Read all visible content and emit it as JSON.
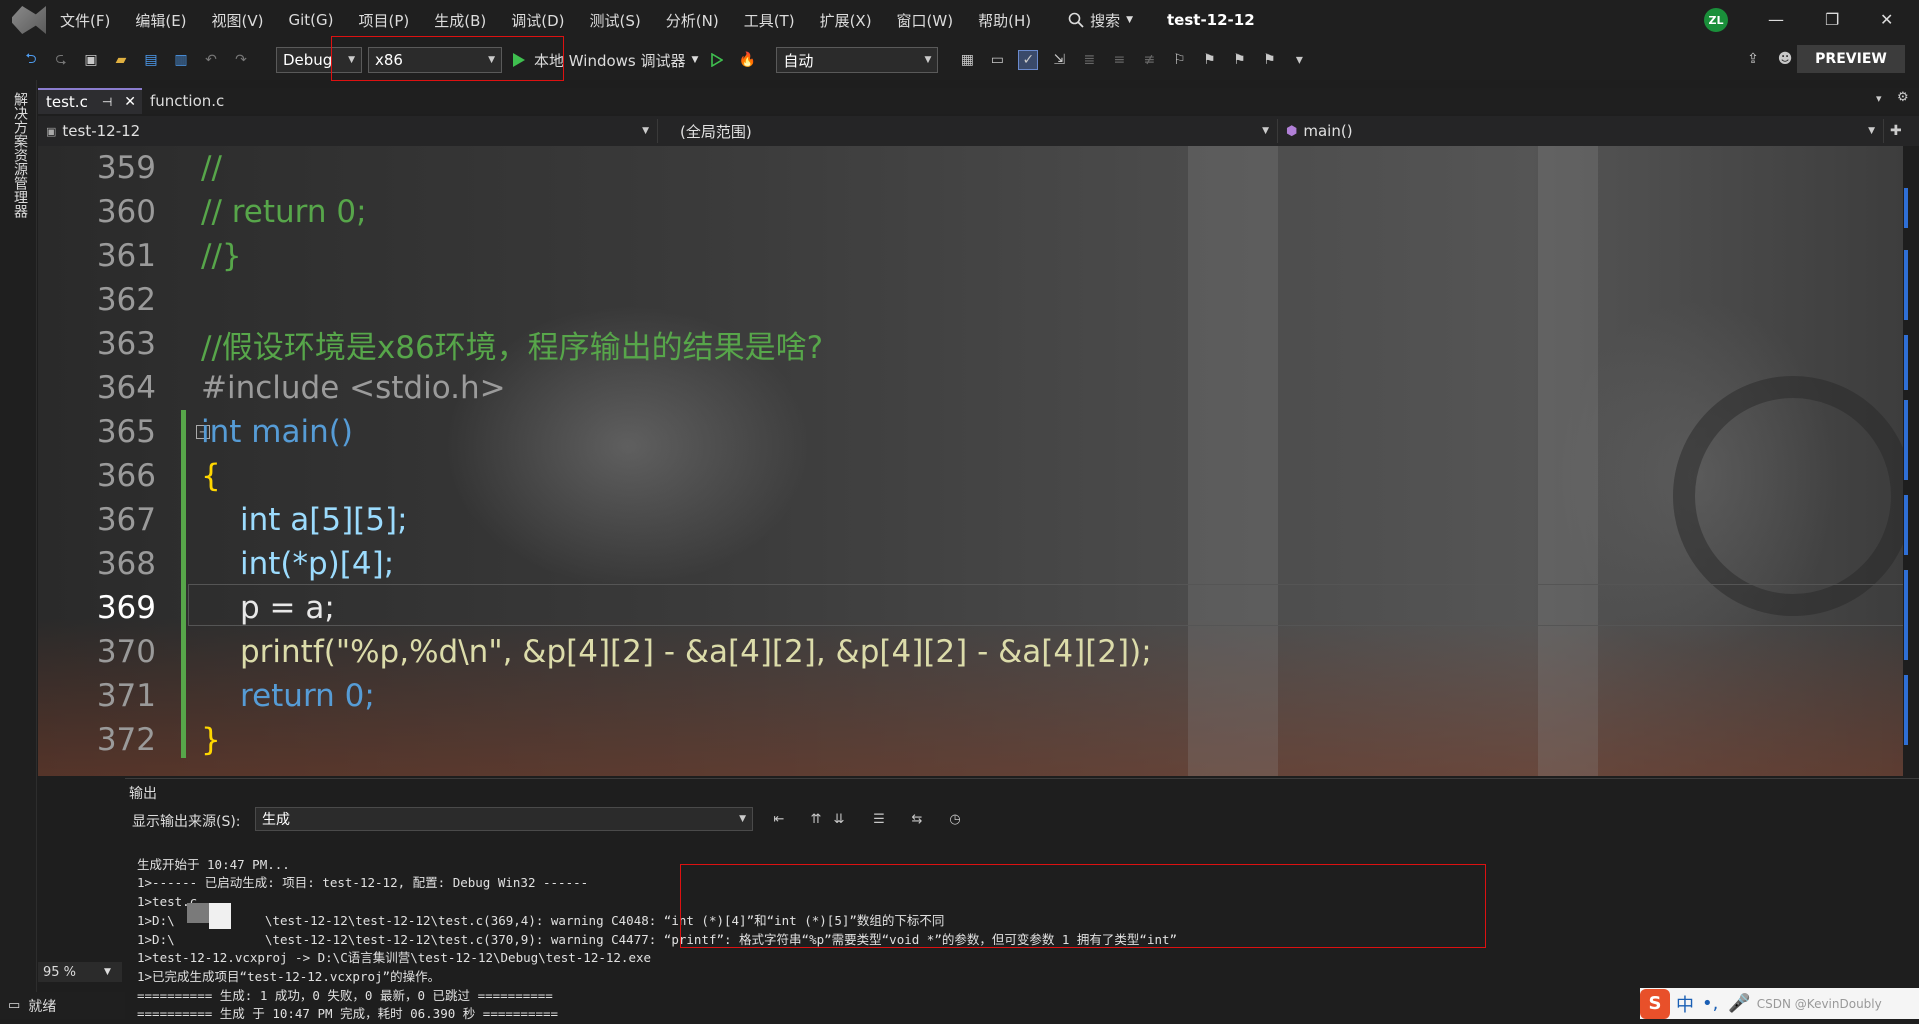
{
  "menubar": {
    "items": [
      "文件(F)",
      "编辑(E)",
      "视图(V)",
      "Git(G)",
      "项目(P)",
      "生成(B)",
      "调试(D)",
      "测试(S)",
      "分析(N)",
      "工具(T)",
      "扩展(X)",
      "窗口(W)",
      "帮助(H)"
    ],
    "search_label": "搜索",
    "solution_title": "test-12-12",
    "avatar_initials": "ZL"
  },
  "toolbar": {
    "config": "Debug",
    "platform": "x86",
    "run_label": "本地 Windows 调试器",
    "mode": "自动",
    "preview_label": "PREVIEW"
  },
  "side_panel_label": "解决方案资源管理器",
  "tabs": [
    {
      "label": "test.c",
      "active": true
    },
    {
      "label": "function.c",
      "active": false
    }
  ],
  "navbar": {
    "project": "test-12-12",
    "scope": "(全局范围)",
    "member": "main()"
  },
  "editor": {
    "current_line": 369,
    "lines": [
      {
        "num": "359",
        "text": "//"
      },
      {
        "num": "360",
        "text": "// return 0;"
      },
      {
        "num": "361",
        "text": "//}"
      },
      {
        "num": "362",
        "text": ""
      },
      {
        "num": "363",
        "text": "//假设环境是x86环境，程序输出的结果是啥?"
      },
      {
        "num": "364",
        "text": "#include <stdio.h>"
      },
      {
        "num": "365",
        "text": "int main()"
      },
      {
        "num": "366",
        "text": "{"
      },
      {
        "num": "367",
        "text": "int a[5][5];"
      },
      {
        "num": "368",
        "text": "int(*p)[4];"
      },
      {
        "num": "369",
        "text": "p = a;"
      },
      {
        "num": "370",
        "text": "printf(\"%p,%d\\n\", &p[4][2] - &a[4][2], &p[4][2] - &a[4][2]);"
      },
      {
        "num": "371",
        "text": "return 0;"
      },
      {
        "num": "372",
        "text": "}"
      }
    ]
  },
  "output": {
    "title": "输出",
    "source_label": "显示输出来源(S):",
    "source_value": "生成",
    "lines": [
      "生成开始于 10:47 PM...",
      "1>------ 已启动生成: 项目: test-12-12, 配置: Debug Win32 ------",
      "1>test.c",
      "1>D:\\            \\test-12-12\\test-12-12\\test.c(369,4): warning C4048: “int (*)[4]”和“int (*)[5]”数组的下标不同",
      "1>D:\\            \\test-12-12\\test-12-12\\test.c(370,9): warning C4477: “printf”: 格式字符串“%p”需要类型“void *”的参数，但可变参数 1 拥有了类型“int”",
      "1>test-12-12.vcxproj -> D:\\C语言集训营\\test-12-12\\Debug\\test-12-12.exe",
      "1>已完成生成项目“test-12-12.vcxproj”的操作。",
      "========== 生成: 1 成功，0 失败，0 最新，0 已跳过 ==========",
      "========== 生成 于 10:47 PM 完成，耗时 06.390 秒 =========="
    ]
  },
  "zoom": "95 %",
  "status": "就绪",
  "ime": {
    "logo": "S",
    "lang": "中",
    "watermark": "CSDN @KevinDoubly"
  },
  "colors": {
    "accent": "#8a7cce",
    "comment": "#57a64a",
    "keyword": "#569cd6",
    "highlight_box": "#dd1111"
  }
}
